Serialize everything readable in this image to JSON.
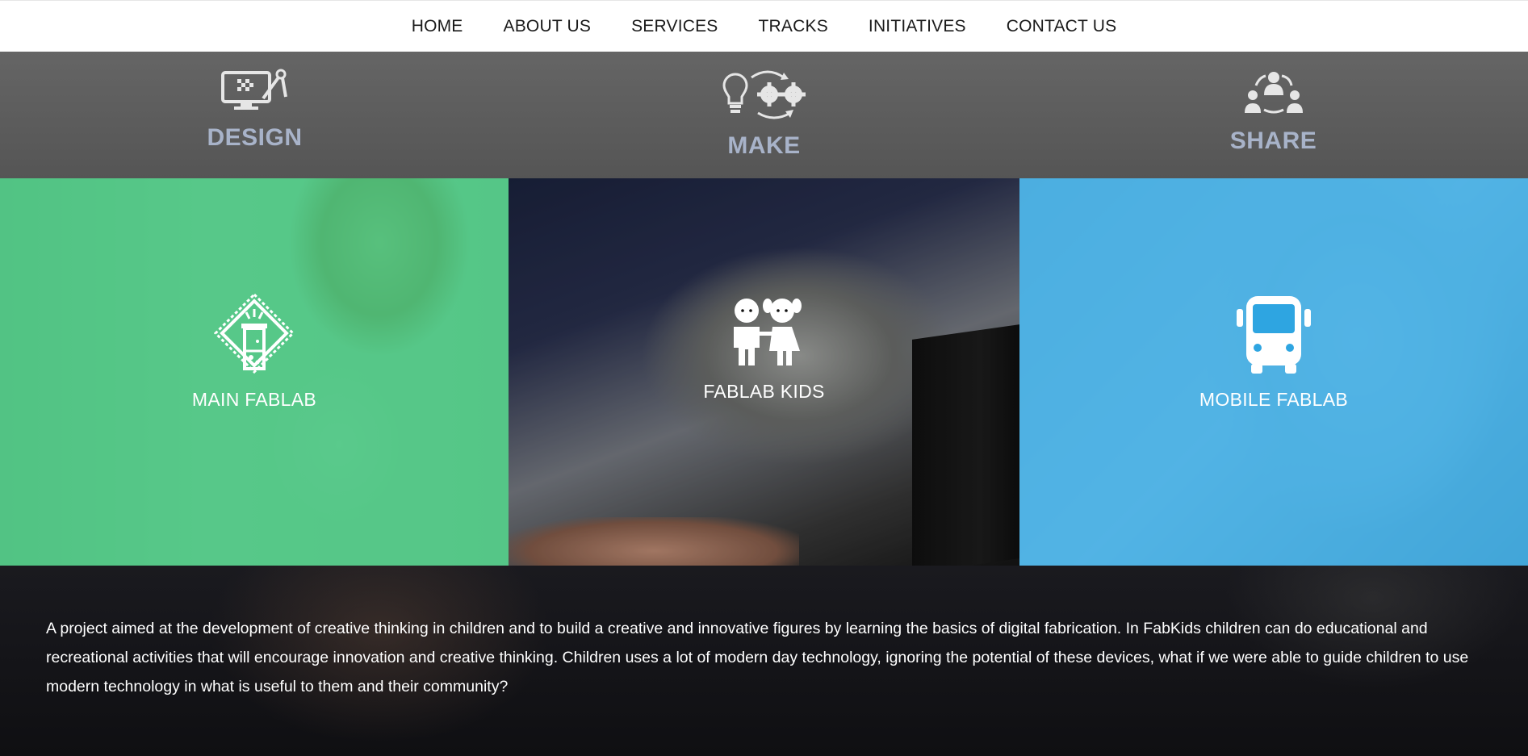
{
  "nav": {
    "items": [
      "HOME",
      "ABOUT US",
      "SERVICES",
      "TRACKS",
      "INITIATIVES",
      "CONTACT US"
    ]
  },
  "pillars": [
    {
      "label": "DESIGN",
      "icon": "design-monitor-compass-icon"
    },
    {
      "label": "MAKE",
      "icon": "lightbulb-gears-icon"
    },
    {
      "label": "SHARE",
      "icon": "people-share-icon"
    }
  ],
  "tiles": [
    {
      "label": "MAIN FABLAB",
      "icon": "lab-beaker-icon",
      "overlay_color": "#2ebe6e"
    },
    {
      "label": "FABLAB KIDS",
      "icon": "kids-icon",
      "overlay_color": "#000000"
    },
    {
      "label": "MOBILE FABLAB",
      "icon": "bus-icon",
      "overlay_color": "#2ea5e1"
    }
  ],
  "description": "A project aimed at the development of creative thinking in children and to build a creative and innovative figures by learning the basics of digital fabrication. In FabKids children can do educational and recreational activities that will encourage innovation and creative thinking. Children uses a lot of modern day technology, ignoring the potential of these devices, what if we were able to guide children to use modern technology in what is useful to them and their community?",
  "colors": {
    "pillar_label": "#a8b3c9",
    "pillar_bg": "#5e5e5e",
    "nav_bg": "#ffffff"
  }
}
